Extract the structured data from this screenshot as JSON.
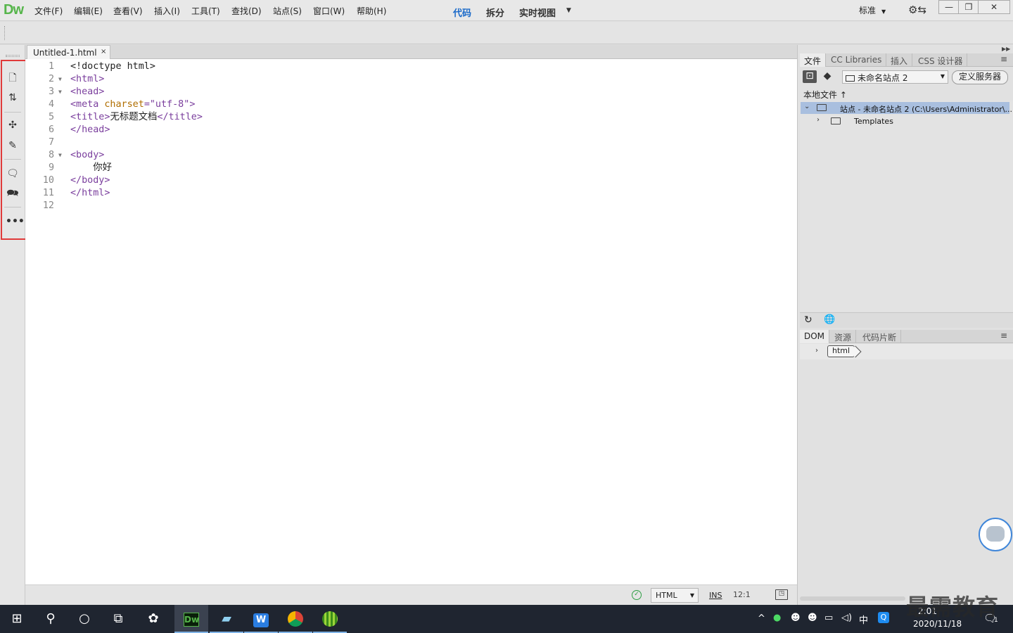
{
  "app": {
    "logo": "Dw",
    "menu": [
      "文件(F)",
      "编辑(E)",
      "查看(V)",
      "插入(I)",
      "工具(T)",
      "查找(D)",
      "站点(S)",
      "窗口(W)",
      "帮助(H)"
    ],
    "workspace": "标准"
  },
  "view_switcher": {
    "code": "代码",
    "split": "拆分",
    "live": "实时视图"
  },
  "document": {
    "tab_label": "Untitled-1.html",
    "close_glyph": "×",
    "lines": [
      {
        "n": "1",
        "fold": "",
        "html": "<span class='txt'>&lt;!doctype html&gt;</span>"
      },
      {
        "n": "2",
        "fold": "▼",
        "html": "<span class='tag'>&lt;html&gt;</span>"
      },
      {
        "n": "3",
        "fold": "▼",
        "html": "<span class='tag'>&lt;head&gt;</span>"
      },
      {
        "n": "4",
        "fold": "",
        "html": "<span class='tag'>&lt;meta </span><span class='attr'>charset</span><span class='tag'>=</span><span class='str'>\"utf-8\"</span><span class='tag'>&gt;</span>"
      },
      {
        "n": "5",
        "fold": "",
        "html": "<span class='tag'>&lt;title&gt;</span><span class='txt'>无标题文档</span><span class='tag'>&lt;/title&gt;</span>"
      },
      {
        "n": "6",
        "fold": "",
        "html": "<span class='tag'>&lt;/head&gt;</span>"
      },
      {
        "n": "7",
        "fold": "",
        "html": ""
      },
      {
        "n": "8",
        "fold": "▼",
        "html": "<span class='tag'>&lt;body&gt;</span>"
      },
      {
        "n": "9",
        "fold": "",
        "html": "<span class='txt'>    你好</span>"
      },
      {
        "n": "10",
        "fold": "",
        "html": "<span class='tag'>&lt;/body&gt;</span>"
      },
      {
        "n": "11",
        "fold": "",
        "html": "<span class='tag'>&lt;/html&gt;</span>"
      },
      {
        "n": "12",
        "fold": "",
        "html": ""
      }
    ]
  },
  "status_bar": {
    "language": "HTML",
    "mode": "INS",
    "cursor": "12:1"
  },
  "files_panel": {
    "tabs": [
      "文件",
      "CC Libraries",
      "插入",
      "CSS 设计器"
    ],
    "site_name": "未命名站点 2",
    "define_server": "定义服务器",
    "local_files": "本地文件",
    "site_root": "站点 - 未命名站点 2 (C:\\Users\\Administrator\\...",
    "templates": "Templates"
  },
  "dom_panel": {
    "tabs": [
      "DOM",
      "资源",
      "代码片断"
    ],
    "node": "html"
  },
  "taskbar": {
    "time": "2:01",
    "date": "2020/11/18",
    "ime": "中",
    "notifications": "1"
  },
  "watermark": "最需教育",
  "colors": {
    "accent_blue": "#1b6ac9",
    "logo_green": "#56b54b",
    "highlight_red": "#e03a3a",
    "tag_purple": "#7a3e9d",
    "attr_orange": "#b06e00"
  }
}
